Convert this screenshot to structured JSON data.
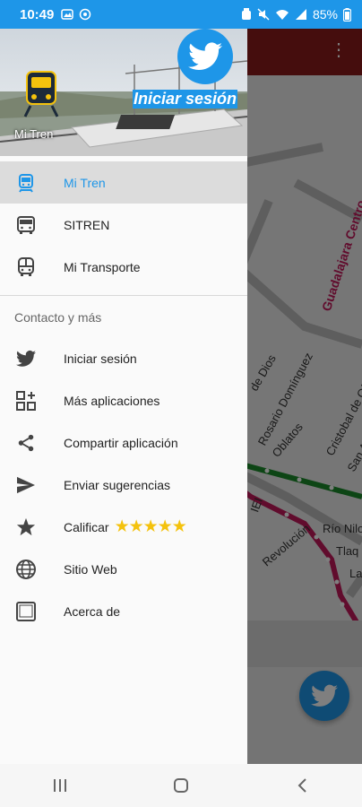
{
  "status_bar": {
    "time": "10:49",
    "battery": "85%"
  },
  "background_app": {
    "map_labels": [
      "Guadalajara Centro",
      "de Dios",
      "Rosario Domínguez",
      "Oblatos",
      "Cristobal de Oñate",
      "San Ap",
      "Revolución",
      "Río Nilo",
      "Tlaq",
      "La",
      "IEI"
    ]
  },
  "drawer": {
    "header": {
      "login_label": "Iniciar sesión",
      "app_name": "Mi Tren"
    },
    "primary_items": [
      {
        "label": "Mi Tren",
        "icon": "train-icon",
        "active": true
      },
      {
        "label": "SITREN",
        "icon": "bus-icon",
        "active": false
      },
      {
        "label": "Mi Transporte",
        "icon": "bus-front-icon",
        "active": false
      }
    ],
    "section_title": "Contacto y más",
    "secondary_items": [
      {
        "label": "Iniciar sesión",
        "icon": "twitter-icon"
      },
      {
        "label": "Más aplicaciones",
        "icon": "apps-grid-icon"
      },
      {
        "label": "Compartir aplicación",
        "icon": "share-icon"
      },
      {
        "label": "Enviar sugerencias",
        "icon": "send-icon"
      },
      {
        "label": "Calificar",
        "icon": "star-icon",
        "extra": "★★★★★"
      },
      {
        "label": "Sitio Web",
        "icon": "globe-icon"
      },
      {
        "label": "Acerca de",
        "icon": "tablet-icon"
      }
    ]
  },
  "colors": {
    "accent": "#1e96e8",
    "appbar": "#8a1a1a",
    "line_green": "#1a8a2a",
    "line_magenta": "#c2185b",
    "stars": "#f4c20d"
  }
}
